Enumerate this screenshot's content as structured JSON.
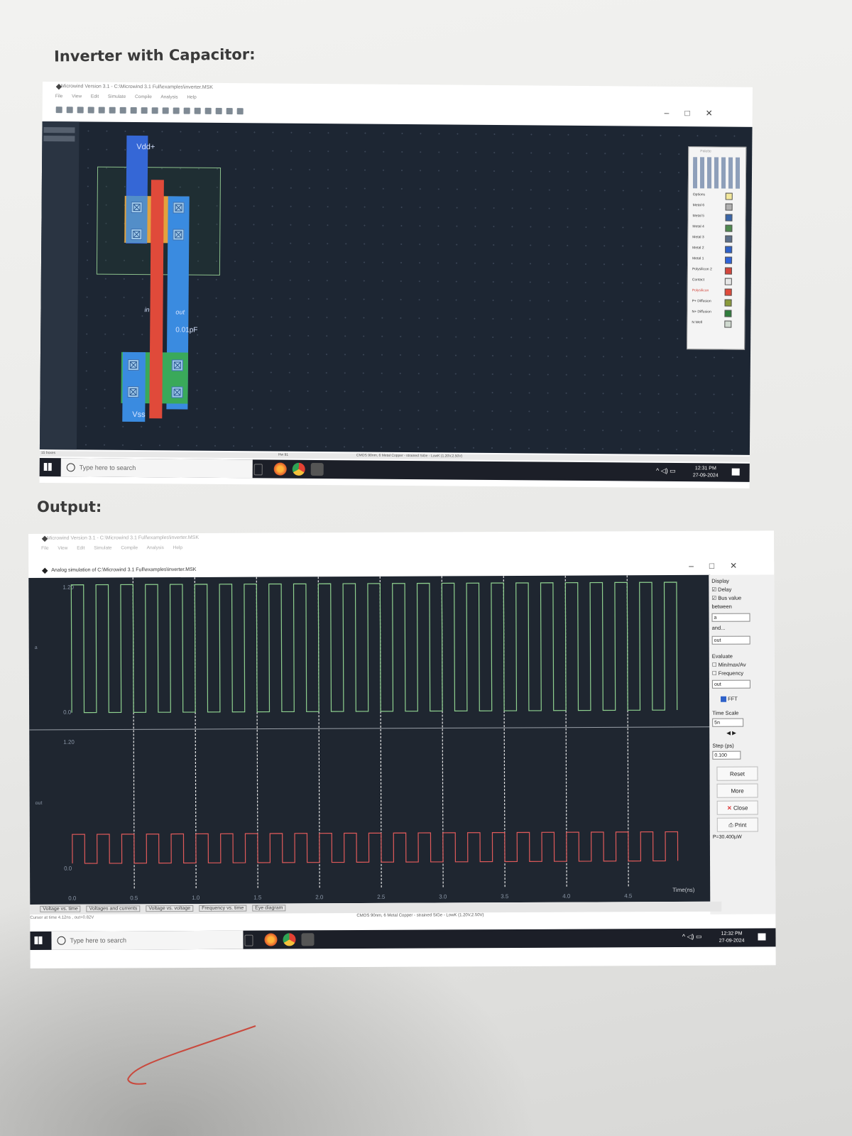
{
  "headings": {
    "layout": "Inverter with Capacitor:",
    "output": "Output:"
  },
  "layout_window": {
    "title": "Microwind Version 3.1 - C:\\Microwind 3.1 Full\\examples\\inverter.MSK",
    "menu": [
      "File",
      "View",
      "Edit",
      "Simulate",
      "Compile",
      "Analysis",
      "Help"
    ],
    "labels": {
      "vdd": "Vdd+",
      "vss": "Vss",
      "in": "in",
      "out": "out",
      "cap": "0.01pF"
    },
    "palette": {
      "title": "Palette",
      "layers": [
        {
          "name": "Options",
          "color": "#f2e79b"
        },
        {
          "name": "Metal 6",
          "color": "#b0b0b0"
        },
        {
          "name": "Metal 5",
          "color": "#3a66a8"
        },
        {
          "name": "Metal 4",
          "color": "#4f8a4f"
        },
        {
          "name": "Metal 3",
          "color": "#5c6f8a"
        },
        {
          "name": "Metal 2",
          "color": "#2e61c9"
        },
        {
          "name": "Metal 1",
          "color": "#2f63d8"
        },
        {
          "name": "Polysilicon 2",
          "color": "#d2453c"
        },
        {
          "name": "Contact",
          "color": "#e6e6e6"
        },
        {
          "name": "Polysilicon",
          "color": "#e04a3a"
        },
        {
          "name": "P+ Diffusion",
          "color": "#8a9a3a"
        },
        {
          "name": "N+ Diffusion",
          "color": "#2f7d3c"
        },
        {
          "name": "N Well",
          "color": "#cfd9cf"
        }
      ]
    },
    "statusbar": "CMOS 90nm, 6 Metal Copper - strained SiGe - LowK (1.20V,2.50V)",
    "left_status": "15 boxes",
    "status_mid": "Hw 91",
    "taskbar": {
      "search_placeholder": "Type here to search",
      "time": "12:31 PM",
      "date": "27-09-2024"
    }
  },
  "sim_window": {
    "title": "Microwind Version 3.1 - C:\\Microwind 3.1 Full\\examples\\inverter.MSK",
    "menu": [
      "File",
      "View",
      "Edit",
      "Simulate",
      "Compile",
      "Analysis",
      "Help"
    ],
    "sim_title": "Analog simulation of C:\\Microwind 3.1 Full\\examples\\inverter.MSK",
    "panel": {
      "display": "Display",
      "delay": "Delay",
      "bus_value": "Bus value",
      "between": "between",
      "a_value": "a",
      "and": "and...",
      "b_value": "out",
      "evaluate": "Evaluate",
      "minmax": "Min/max/Av",
      "frequency": "Frequency",
      "eval_value": "out",
      "fft": "FFT",
      "time_scale": "Time Scale",
      "time_scale_value": "5n",
      "step_label": "Step (ps)",
      "step_value": "0.100",
      "reset": "Reset",
      "more": "More",
      "close": "Close",
      "print": "Print",
      "power": "P=30.400µW"
    },
    "tabs": [
      "Voltage vs. time",
      "Voltages and currents",
      "Voltage vs. voltage",
      "Frequency vs. time",
      "Eye diagram"
    ],
    "cursor_text": "Cursor at time 4.12ns , out=0.82V",
    "statusbar": "CMOS 90nm, 6 Metal Copper - strained SiGe - LowK (1.20V,2.50V)",
    "taskbar": {
      "search_placeholder": "Type here to search",
      "time": "12:32 PM",
      "date": "27-09-2024"
    }
  },
  "chart_data": {
    "type": "line",
    "xlabel": "Time(ns)",
    "xticks": [
      "0.0",
      "0.5",
      "1.0",
      "1.5",
      "2.0",
      "2.5",
      "3.0",
      "3.5",
      "4.0",
      "4.5"
    ],
    "xlim": [
      0,
      5
    ],
    "panels": [
      {
        "name": "a",
        "ytop": "1.20",
        "ybottom": "0.0",
        "color": "#8fd18f",
        "period_ns": 0.2,
        "high": 1.2,
        "low": 0.0
      },
      {
        "name": "out",
        "ytop": "1.20",
        "ybottom": "0.0",
        "color": "#e05a5a",
        "period_ns": 0.2,
        "high": 0.32,
        "low": 0.05
      }
    ]
  }
}
